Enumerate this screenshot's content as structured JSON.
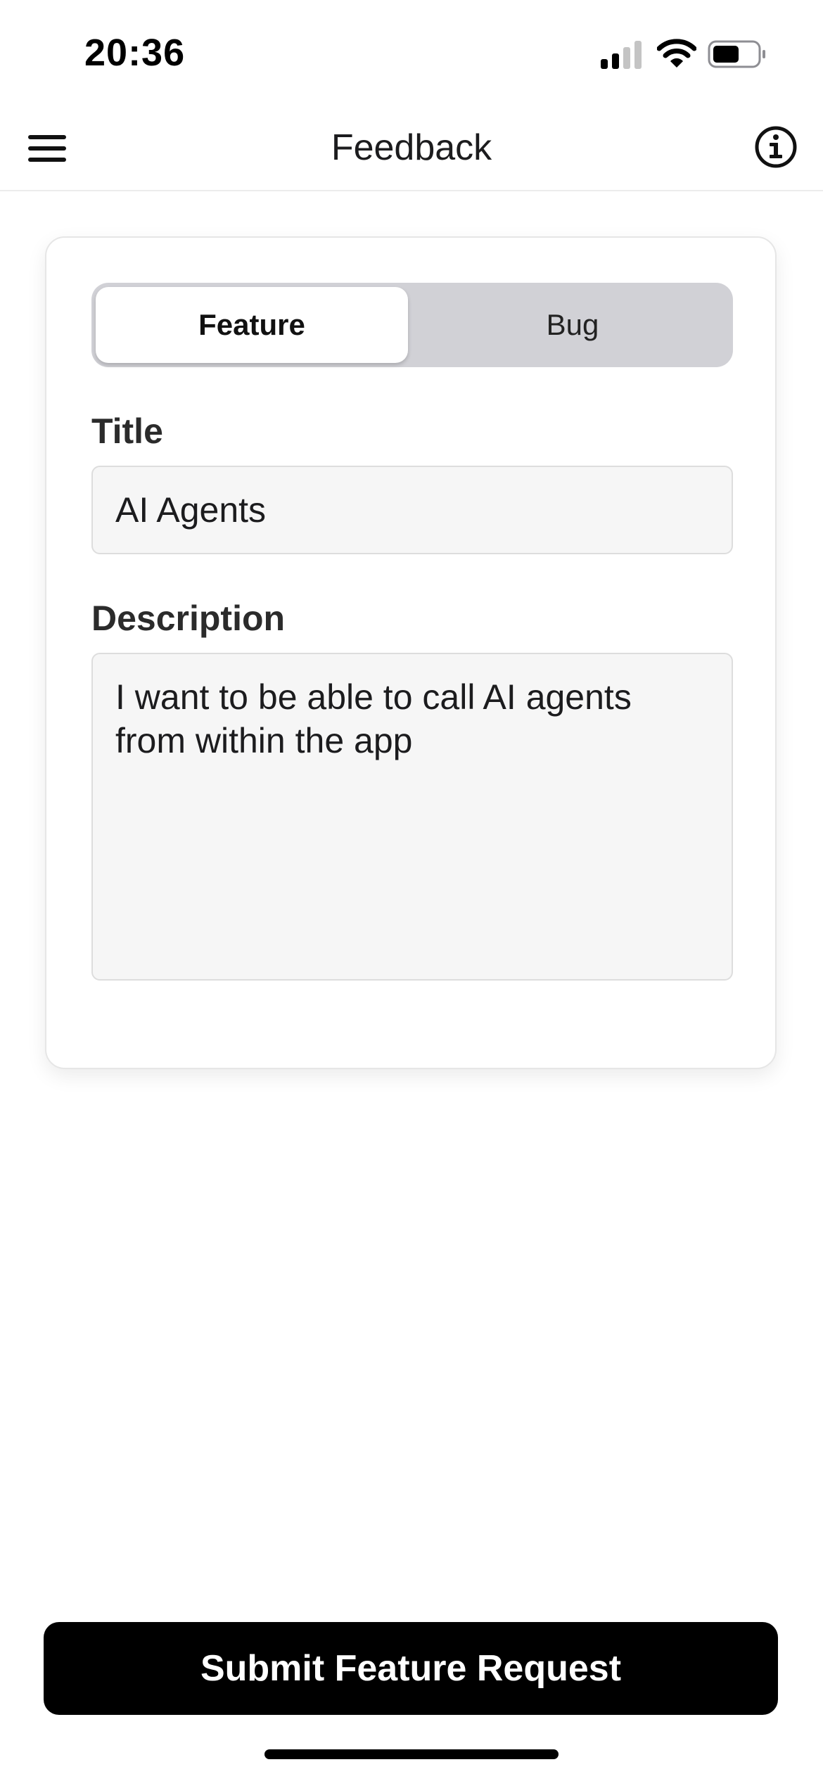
{
  "status_bar": {
    "time": "20:36",
    "icons": [
      "signal-icon",
      "wifi-icon",
      "battery-icon"
    ]
  },
  "nav": {
    "title": "Feedback",
    "left_icon": "menu-icon",
    "right_icon": "info-icon"
  },
  "form": {
    "segments": [
      {
        "label": "Feature",
        "selected": true
      },
      {
        "label": "Bug",
        "selected": false
      }
    ],
    "title_label": "Title",
    "title_value": "AI Agents",
    "description_label": "Description",
    "description_value": "I want to be able to call AI agents from within the app"
  },
  "submit": {
    "label": "Submit Feature Request"
  },
  "colors": {
    "accent": "#000000",
    "segment_bg": "#d1d1d6",
    "input_bg": "#f6f6f6"
  }
}
